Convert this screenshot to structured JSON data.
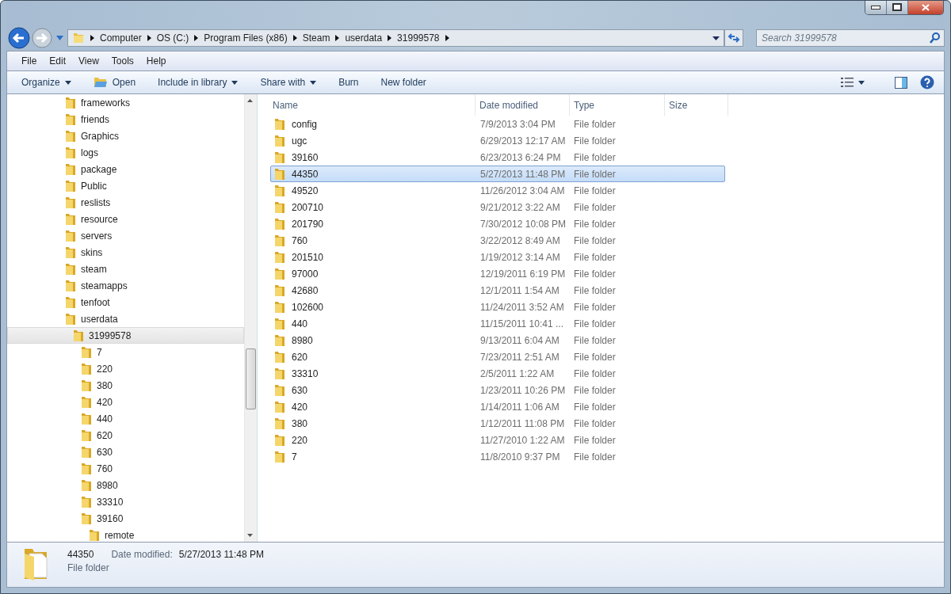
{
  "address_bar": {
    "crumbs": [
      "Computer",
      "OS (C:)",
      "Program Files (x86)",
      "Steam",
      "userdata",
      "31999578"
    ]
  },
  "search": {
    "placeholder": "Search 31999578"
  },
  "menu": [
    "File",
    "Edit",
    "View",
    "Tools",
    "Help"
  ],
  "toolbar": [
    {
      "label": "Organize",
      "kind": "dropdown"
    },
    {
      "label": "Open",
      "kind": "icon"
    },
    {
      "label": "Include in library",
      "kind": "dropdown"
    },
    {
      "label": "Share with",
      "kind": "dropdown"
    },
    {
      "label": "Burn",
      "kind": "plain"
    },
    {
      "label": "New folder",
      "kind": "plain"
    }
  ],
  "tree": [
    {
      "name": "frameworks",
      "selected": false
    },
    {
      "name": "friends",
      "selected": false
    },
    {
      "name": "Graphics",
      "selected": false
    },
    {
      "name": "logs",
      "selected": false
    },
    {
      "name": "package",
      "selected": false
    },
    {
      "name": "Public",
      "selected": false
    },
    {
      "name": "reslists",
      "selected": false
    },
    {
      "name": "resource",
      "selected": false
    },
    {
      "name": "servers",
      "selected": false
    },
    {
      "name": "skins",
      "selected": false
    },
    {
      "name": "steam",
      "selected": false
    },
    {
      "name": "steamapps",
      "selected": false
    },
    {
      "name": "tenfoot",
      "selected": false
    },
    {
      "name": "userdata",
      "selected": false,
      "children": [
        {
          "name": "31999578",
          "selected": true,
          "children": [
            {
              "name": "7",
              "selected": false
            },
            {
              "name": "220",
              "selected": false
            },
            {
              "name": "380",
              "selected": false
            },
            {
              "name": "420",
              "selected": false
            },
            {
              "name": "440",
              "selected": false
            },
            {
              "name": "620",
              "selected": false
            },
            {
              "name": "630",
              "selected": false
            },
            {
              "name": "760",
              "selected": false
            },
            {
              "name": "8980",
              "selected": false
            },
            {
              "name": "33310",
              "selected": false
            },
            {
              "name": "39160",
              "selected": false,
              "children": [
                {
                  "name": "remote",
                  "selected": false
                }
              ]
            }
          ]
        }
      ]
    }
  ],
  "table": {
    "columns": [
      "Name",
      "Date modified",
      "Type",
      "Size"
    ],
    "rows": [
      {
        "name": "config",
        "date": "7/9/2013 3:04 PM",
        "type": "File folder",
        "selected": false
      },
      {
        "name": "ugc",
        "date": "6/29/2013 12:17 AM",
        "type": "File folder",
        "selected": false
      },
      {
        "name": "39160",
        "date": "6/23/2013 6:24 PM",
        "type": "File folder",
        "selected": false
      },
      {
        "name": "44350",
        "date": "5/27/2013 11:48 PM",
        "type": "File folder",
        "selected": true
      },
      {
        "name": "49520",
        "date": "11/26/2012 3:04 AM",
        "type": "File folder",
        "selected": false
      },
      {
        "name": "200710",
        "date": "9/21/2012 3:22 AM",
        "type": "File folder",
        "selected": false
      },
      {
        "name": "201790",
        "date": "7/30/2012 10:08 PM",
        "type": "File folder",
        "selected": false
      },
      {
        "name": "760",
        "date": "3/22/2012 8:49 AM",
        "type": "File folder",
        "selected": false
      },
      {
        "name": "201510",
        "date": "1/19/2012 3:14 AM",
        "type": "File folder",
        "selected": false
      },
      {
        "name": "97000",
        "date": "12/19/2011 6:19 PM",
        "type": "File folder",
        "selected": false
      },
      {
        "name": "42680",
        "date": "12/1/2011 1:54 AM",
        "type": "File folder",
        "selected": false
      },
      {
        "name": "102600",
        "date": "11/24/2011 3:52 AM",
        "type": "File folder",
        "selected": false
      },
      {
        "name": "440",
        "date": "11/15/2011 10:41 ...",
        "type": "File folder",
        "selected": false
      },
      {
        "name": "8980",
        "date": "9/13/2011 6:04 AM",
        "type": "File folder",
        "selected": false
      },
      {
        "name": "620",
        "date": "7/23/2011 2:51 AM",
        "type": "File folder",
        "selected": false
      },
      {
        "name": "33310",
        "date": "2/5/2011 1:22 AM",
        "type": "File folder",
        "selected": false
      },
      {
        "name": "630",
        "date": "1/23/2011 10:26 PM",
        "type": "File folder",
        "selected": false
      },
      {
        "name": "420",
        "date": "1/14/2011 1:06 AM",
        "type": "File folder",
        "selected": false
      },
      {
        "name": "380",
        "date": "1/12/2011 11:08 PM",
        "type": "File folder",
        "selected": false
      },
      {
        "name": "220",
        "date": "11/27/2010 1:22 AM",
        "type": "File folder",
        "selected": false
      },
      {
        "name": "7",
        "date": "11/8/2010 9:37 PM",
        "type": "File folder",
        "selected": false
      }
    ]
  },
  "details": {
    "name": "44350",
    "date_label": "Date modified:",
    "date": "5/27/2013 11:48 PM",
    "type": "File folder"
  }
}
